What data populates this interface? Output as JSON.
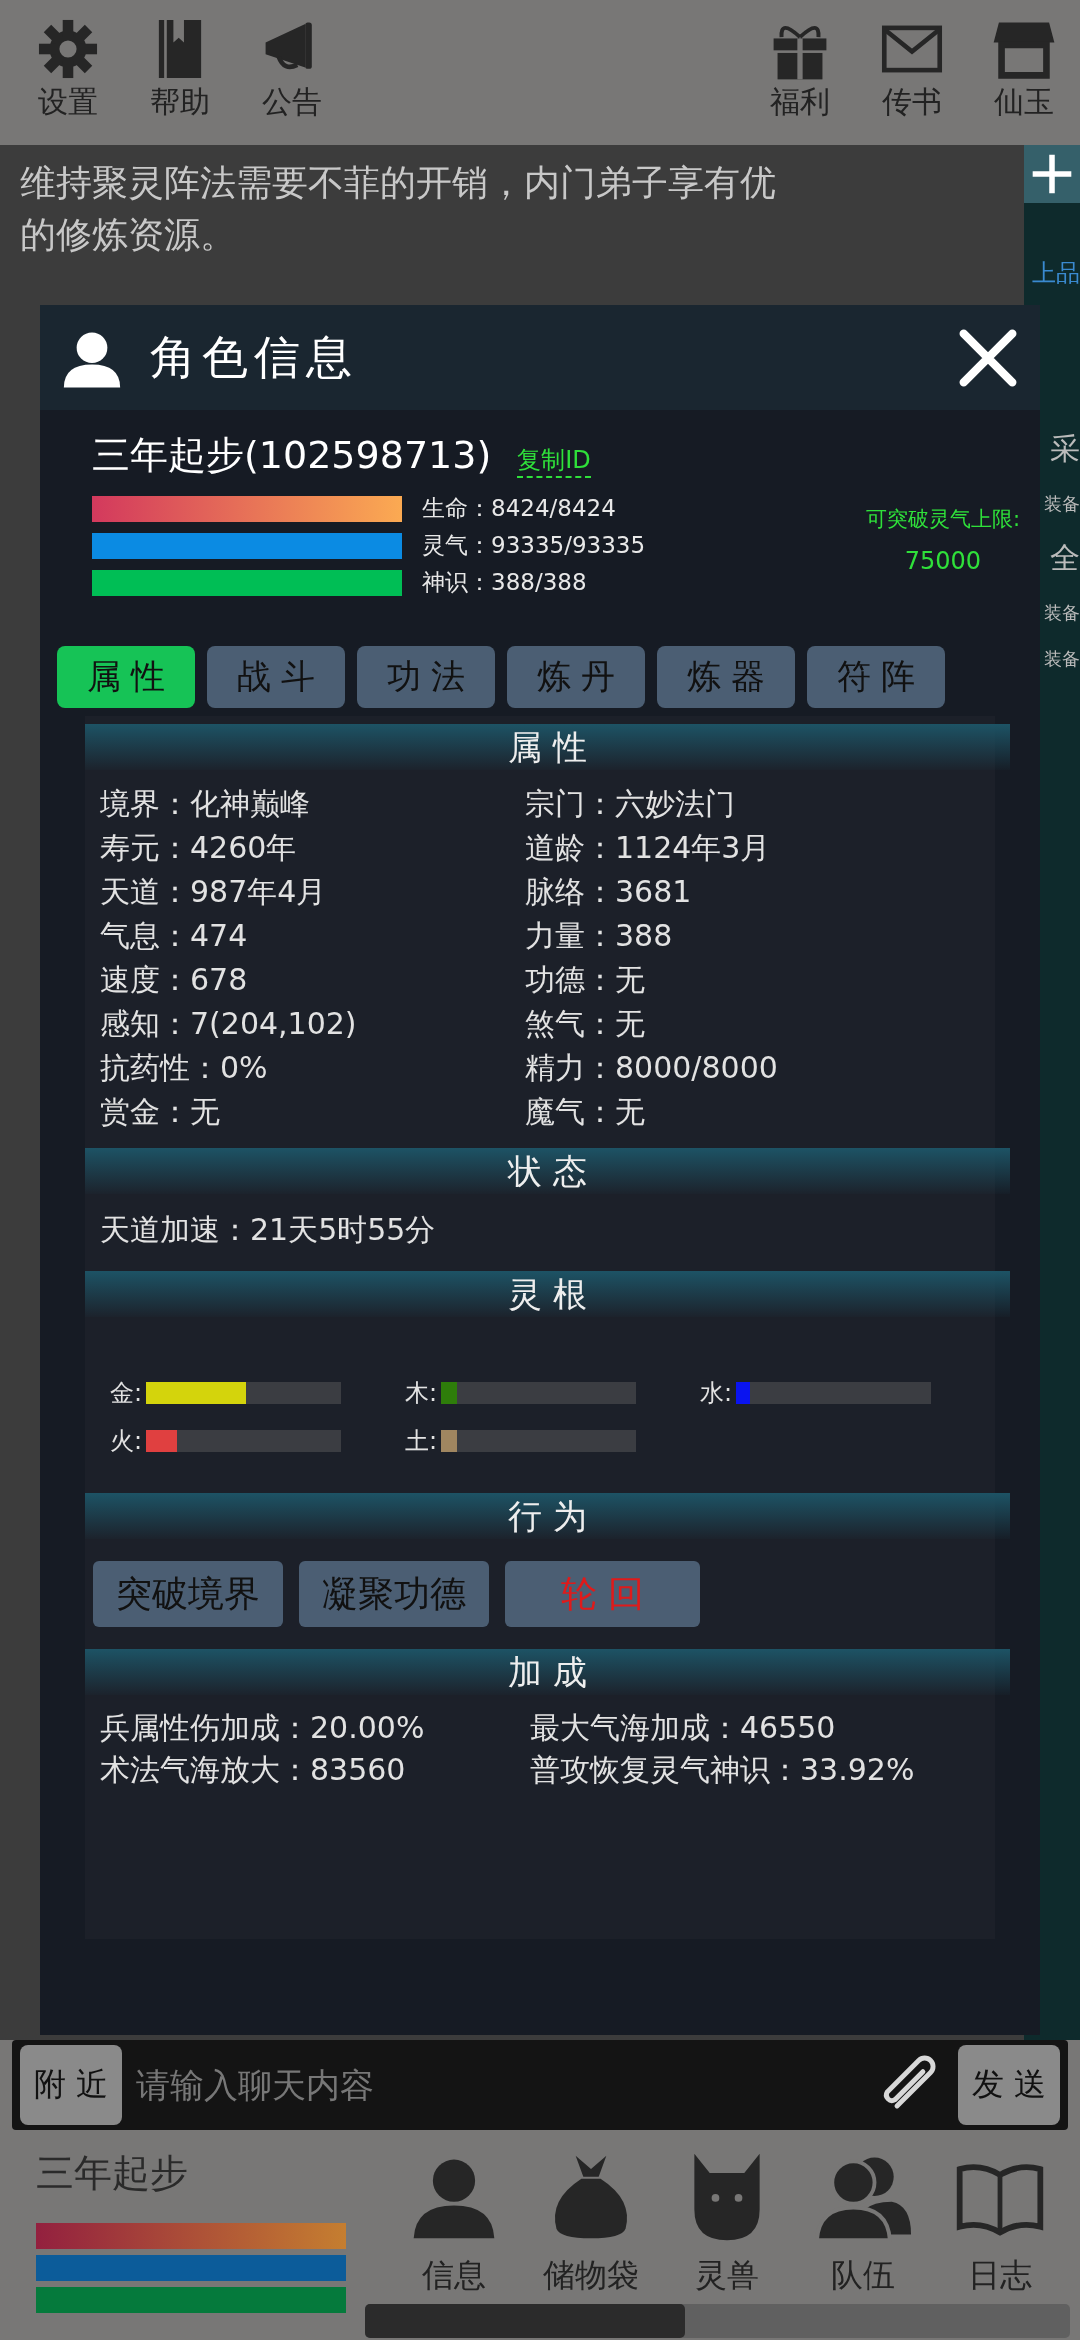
{
  "top_bar": {
    "left": [
      {
        "label": "设置"
      },
      {
        "label": "帮助"
      },
      {
        "label": "公告"
      }
    ],
    "right": [
      {
        "label": "福利"
      },
      {
        "label": "传书"
      },
      {
        "label": "仙玉"
      }
    ]
  },
  "notice": {
    "lines": [
      "维持聚灵阵法需要不菲的开销，内门弟子享有优",
      "的修炼资源。"
    ]
  },
  "side_strip": {
    "items": [
      {
        "text": "上品",
        "kind": "blue"
      },
      {
        "text": "采",
        "kind": "plain"
      },
      {
        "text": "装备",
        "kind": "small"
      },
      {
        "text": "全",
        "kind": "plain"
      },
      {
        "text": "装备",
        "kind": "small"
      },
      {
        "text": "装备",
        "kind": "small"
      }
    ]
  },
  "dialog": {
    "title": "角色信息",
    "player": {
      "name": "三年起步(102598713)",
      "copy_link": "复制ID"
    },
    "stats": [
      {
        "text": "生命：8424/8424",
        "level": 1,
        "kind": "life"
      },
      {
        "text": "灵气：93335/93335",
        "level": 1,
        "kind": "qi"
      },
      {
        "text": "神识：388/388",
        "level": 1,
        "kind": "mind"
      }
    ],
    "breakthrough": {
      "label": "可突破灵气上限:",
      "value": "75000"
    },
    "tabs": [
      {
        "label": "属 性",
        "selected": true
      },
      {
        "label": "战 斗",
        "selected": false
      },
      {
        "label": "功 法",
        "selected": false
      },
      {
        "label": "炼 丹",
        "selected": false
      },
      {
        "label": "炼 器",
        "selected": false
      },
      {
        "label": "符 阵",
        "selected": false
      }
    ],
    "attributes": {
      "title": "属 性",
      "items": [
        "境界：化神巅峰",
        "宗门：六妙法门",
        "寿元：4260年",
        "道龄：1124年3月",
        "天道：987年4月",
        "脉络：3681",
        "气息：474",
        "力量：388",
        "速度：678",
        "功德：无",
        "感知：7(204,102)",
        "煞气：无",
        "抗药性：0%",
        "精力：8000/8000",
        "赏金：无",
        "魔气：无"
      ]
    },
    "status": {
      "title": "状 态",
      "items": [
        "天道加速：21天5时55分"
      ]
    },
    "roots": {
      "title": "灵 根",
      "items": [
        {
          "label": "金:",
          "level": 0.51,
          "color": "#d4d40c"
        },
        {
          "label": "木:",
          "level": 0.08,
          "color": "#2e7d0a"
        },
        {
          "label": "水:",
          "level": 0.07,
          "color": "#0a14f0"
        },
        {
          "label": "火:",
          "level": 0.16,
          "color": "#e04040"
        },
        {
          "label": "土:",
          "level": 0.08,
          "color": "#a08660"
        }
      ]
    },
    "actions": {
      "title": "行 为",
      "buttons": [
        {
          "label": "突破境界",
          "kind": "normal"
        },
        {
          "label": "凝聚功德",
          "kind": "normal"
        },
        {
          "label": "轮 回",
          "kind": "danger"
        }
      ]
    },
    "bonuses": {
      "title": "加 成",
      "items": [
        "兵属性伤加成：20.00%",
        "最大气海加成：46550",
        "术法气海放大：83560",
        "普攻恢复灵气神识：33.92%"
      ]
    }
  },
  "chat": {
    "channel": "附 近",
    "placeholder": "请输入聊天内容",
    "send": "发 送"
  },
  "player_panel": {
    "name": "三年起步",
    "bars": [
      {
        "kind": "life"
      },
      {
        "kind": "qi"
      },
      {
        "kind": "mind"
      }
    ]
  },
  "nav": [
    {
      "label": "信息"
    },
    {
      "label": "储物袋"
    },
    {
      "label": "灵兽"
    },
    {
      "label": "队伍"
    },
    {
      "label": "日志"
    }
  ]
}
